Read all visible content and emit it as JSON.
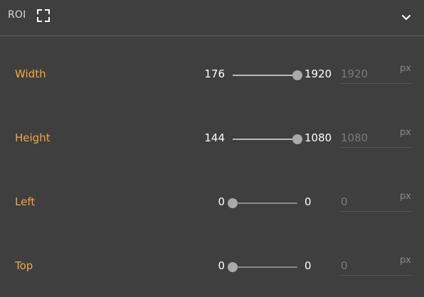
{
  "panel": {
    "title": "ROI",
    "icons": {
      "roi": "fullscreen-frame-icon",
      "toggle": "chevron-down-icon"
    }
  },
  "colors": {
    "label": "#f2a93b",
    "background": "#3f3f3f",
    "thumb": "#a9a9a9"
  },
  "rows": [
    {
      "label": "Width",
      "min": "176",
      "max": "1920",
      "value": "1920",
      "unit": "px",
      "position": 1.0
    },
    {
      "label": "Height",
      "min": "144",
      "max": "1080",
      "value": "1080",
      "unit": "px",
      "position": 1.0
    },
    {
      "label": "Left",
      "min": "0",
      "max": "0",
      "value": "0",
      "unit": "px",
      "position": 0.0
    },
    {
      "label": "Top",
      "min": "0",
      "max": "0",
      "value": "0",
      "unit": "px",
      "position": 0.0
    }
  ]
}
